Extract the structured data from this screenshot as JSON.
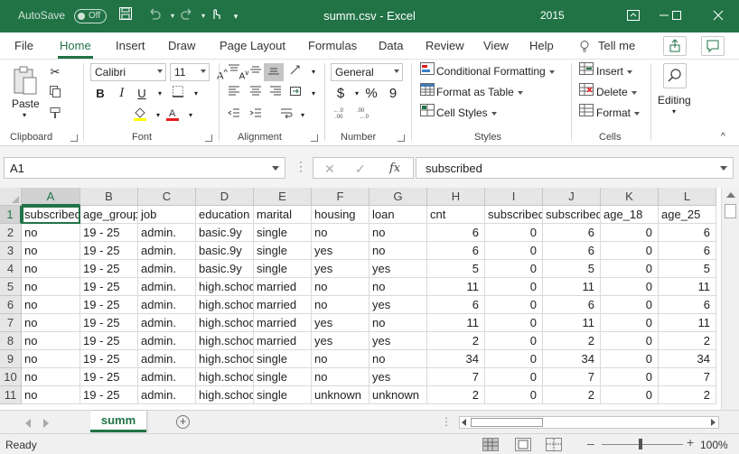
{
  "titlebar": {
    "autosave_label": "AutoSave",
    "autosave_state": "Off",
    "title": "summ.csv  -  Excel",
    "version": "2015",
    "accent": "#217346"
  },
  "ribbon_tabs": [
    "File",
    "Home",
    "Insert",
    "Draw",
    "Page Layout",
    "Formulas",
    "Data",
    "Review",
    "View",
    "Help"
  ],
  "active_tab": "Home",
  "tell_me": "Tell me",
  "clipboard": {
    "paste": "Paste",
    "label": "Clipboard"
  },
  "font": {
    "name": "Calibri",
    "size": "11",
    "bold": "B",
    "italic": "I",
    "underline": "U",
    "label": "Font"
  },
  "alignment": {
    "label": "Alignment"
  },
  "number": {
    "format": "General",
    "currency": "$",
    "percent": "%",
    "comma": "9",
    "label": "Number"
  },
  "styles": {
    "conditional": "Conditional Formatting",
    "format_table": "Format as Table",
    "cell_styles": "Cell Styles",
    "label": "Styles"
  },
  "cells": {
    "insert": "Insert",
    "delete": "Delete",
    "format": "Format",
    "label": "Cells"
  },
  "editing": {
    "label": "Editing"
  },
  "formula_bar": {
    "name_box": "A1",
    "content": "subscribed",
    "fx": "fx"
  },
  "columns": [
    "A",
    "B",
    "C",
    "D",
    "E",
    "F",
    "G",
    "H",
    "I",
    "J",
    "K",
    "L"
  ],
  "rows": [
    [
      "subscribed",
      "age_group",
      "job",
      "education",
      "marital",
      "housing",
      "loan",
      "cnt",
      "subscribed",
      "subscribed",
      "age_18",
      "age_25"
    ],
    [
      "no",
      "19 - 25",
      "admin.",
      "basic.9y",
      "single",
      "no",
      "no",
      "6",
      "0",
      "6",
      "0",
      "6"
    ],
    [
      "no",
      "19 - 25",
      "admin.",
      "basic.9y",
      "single",
      "yes",
      "no",
      "6",
      "0",
      "6",
      "0",
      "6"
    ],
    [
      "no",
      "19 - 25",
      "admin.",
      "basic.9y",
      "single",
      "yes",
      "yes",
      "5",
      "0",
      "5",
      "0",
      "5"
    ],
    [
      "no",
      "19 - 25",
      "admin.",
      "high.school",
      "married",
      "no",
      "no",
      "11",
      "0",
      "11",
      "0",
      "11"
    ],
    [
      "no",
      "19 - 25",
      "admin.",
      "high.school",
      "married",
      "no",
      "yes",
      "6",
      "0",
      "6",
      "0",
      "6"
    ],
    [
      "no",
      "19 - 25",
      "admin.",
      "high.school",
      "married",
      "yes",
      "no",
      "11",
      "0",
      "11",
      "0",
      "11"
    ],
    [
      "no",
      "19 - 25",
      "admin.",
      "high.school",
      "married",
      "yes",
      "yes",
      "2",
      "0",
      "2",
      "0",
      "2"
    ],
    [
      "no",
      "19 - 25",
      "admin.",
      "high.school",
      "single",
      "no",
      "no",
      "34",
      "0",
      "34",
      "0",
      "34"
    ],
    [
      "no",
      "19 - 25",
      "admin.",
      "high.school",
      "single",
      "no",
      "yes",
      "7",
      "0",
      "7",
      "0",
      "7"
    ],
    [
      "no",
      "19 - 25",
      "admin.",
      "high.school",
      "single",
      "unknown",
      "unknown",
      "2",
      "0",
      "2",
      "0",
      "2"
    ]
  ],
  "sheet_tab": "summ",
  "status": "Ready",
  "zoom": "100%"
}
